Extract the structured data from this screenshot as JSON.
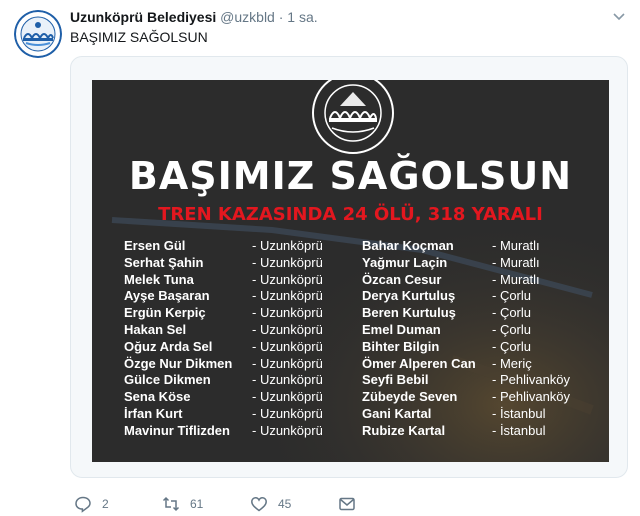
{
  "tweet": {
    "author_name": "Uzunköprü Belediyesi",
    "handle": "@uzkbld",
    "separator": "·",
    "time": "1 sa.",
    "text": "BAŞIMIZ SAĞOLSUN"
  },
  "poster": {
    "headline": "BAŞIMIZ SAĞOLSUN",
    "subheadline": "TREN KAZASINDA 24 ÖLÜ, 318 YARALI",
    "seal_text": "UZUNKÖPRÜ 1868 BELEDİYESİ",
    "victims_left": [
      {
        "name": "Ersen Gül",
        "place": "- Uzunköprü"
      },
      {
        "name": "Serhat Şahin",
        "place": "- Uzunköprü"
      },
      {
        "name": "Melek Tuna",
        "place": "- Uzunköprü"
      },
      {
        "name": "Ayşe Başaran",
        "place": "- Uzunköprü"
      },
      {
        "name": "Ergün Kerpiç",
        "place": "- Uzunköprü"
      },
      {
        "name": "Hakan Sel",
        "place": "- Uzunköprü"
      },
      {
        "name": "Oğuz Arda Sel",
        "place": "- Uzunköprü"
      },
      {
        "name": "Özge Nur Dikmen",
        "place": "- Uzunköprü"
      },
      {
        "name": "Gülce Dikmen",
        "place": "- Uzunköprü"
      },
      {
        "name": "Sena Köse",
        "place": "- Uzunköprü"
      },
      {
        "name": "İrfan Kurt",
        "place": "- Uzunköprü"
      },
      {
        "name": "Mavinur Tiflizden",
        "place": "- Uzunköprü"
      }
    ],
    "victims_right": [
      {
        "name": "Bahar Koçman",
        "place": "- Muratlı"
      },
      {
        "name": "Yağmur Laçin",
        "place": "- Muratlı"
      },
      {
        "name": "Özcan Cesur",
        "place": "- Muratlı"
      },
      {
        "name": "Derya Kurtuluş",
        "place": "- Çorlu"
      },
      {
        "name": "Beren Kurtuluş",
        "place": "- Çorlu"
      },
      {
        "name": "Emel Duman",
        "place": "- Çorlu"
      },
      {
        "name": "Bihter Bilgin",
        "place": "- Çorlu"
      },
      {
        "name": "Ömer Alperen Can",
        "place": "- Meriç"
      },
      {
        "name": "Seyfi Bebil",
        "place": "- Pehlivanköy"
      },
      {
        "name": "Zübeyde Seven",
        "place": "- Pehlivanköy"
      },
      {
        "name": "Gani Kartal",
        "place": "- İstanbul"
      },
      {
        "name": "Rubize Kartal",
        "place": "- İstanbul"
      }
    ]
  },
  "actions": {
    "reply_count": "2",
    "retweet_count": "61",
    "like_count": "45",
    "reply_icon": "reply-icon",
    "retweet_icon": "retweet-icon",
    "like_icon": "heart-icon",
    "dm_icon": "envelope-icon"
  },
  "colors": {
    "headline": "#ffffff",
    "subheadline": "#e3171f",
    "poster_bg": "#2e2e2e",
    "secondary_text": "#657786",
    "logo_blue": "#1f5fa8"
  }
}
